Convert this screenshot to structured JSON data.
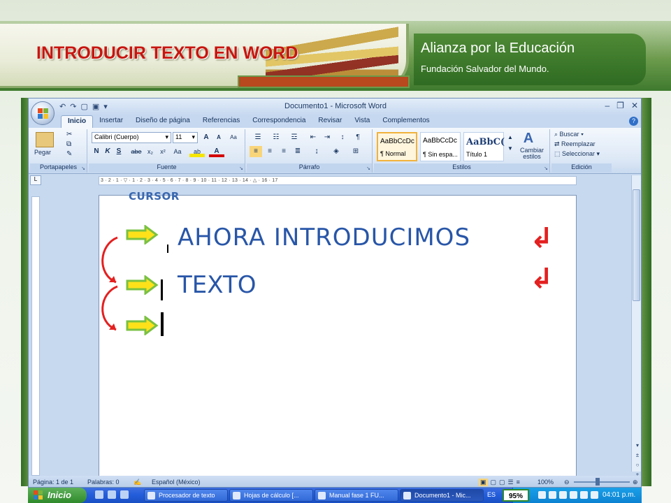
{
  "slide": {
    "title": "INTRODUCIR TEXTO EN WORD",
    "org_name": "Alianza por la Educación",
    "org_sub": "Fundación Salvador del Mundo."
  },
  "word": {
    "window_title": "Documento1 - Microsoft Word",
    "tabs": [
      "Inicio",
      "Insertar",
      "Diseño de página",
      "Referencias",
      "Correspondencia",
      "Revisar",
      "Vista",
      "Complementos"
    ],
    "active_tab": "Inicio",
    "ribbon": {
      "paste_label": "Pegar",
      "font_name": "Calibri (Cuerpo)",
      "font_size": "11",
      "styles": [
        {
          "sample": "AaBbCcDc",
          "name": "¶ Normal"
        },
        {
          "sample": "AaBbCcDc",
          "name": "¶ Sin espa..."
        },
        {
          "sample": "AaBbC(",
          "name": "Título 1"
        }
      ],
      "change_styles_label": "Cambiar estilos",
      "find_label": "Buscar",
      "replace_label": "Reemplazar",
      "select_label": "Seleccionar",
      "groups": [
        "Portapapeles",
        "Fuente",
        "Párrafo",
        "Estilos",
        "Edición"
      ]
    },
    "ruler_text": "3 · 2 · 1 · ▽ · 1 · 2 · 3 · 4 · 5 · 6 · 7 · 8 · 9 · 10 · 11 · 12 · 13 · 14 · △ · 16 · 17",
    "statusbar": {
      "page": "Página: 1 de 1",
      "words": "Palabras: 0",
      "language": "Español (México)",
      "zoom": "100%"
    }
  },
  "annotation": {
    "cursor_label": "CURSOR",
    "line1": "AHORA INTRODUCIMOS",
    "line2": "TEXTO",
    "enter_symbol": "↲"
  },
  "taskbar": {
    "start_label": "Inicio",
    "tasks": [
      "Procesador de texto",
      "Hojas de cálculo [...",
      "Manual fase 1 FU...",
      "Documento1 - Mic..."
    ],
    "language": "ES",
    "zoom": "95%",
    "time": "04:01 p.m."
  },
  "colors": {
    "title_red": "#c8150f",
    "doc_blue": "#2856a8",
    "arrow_green": "#7ac142",
    "enter_red": "#e42020"
  }
}
